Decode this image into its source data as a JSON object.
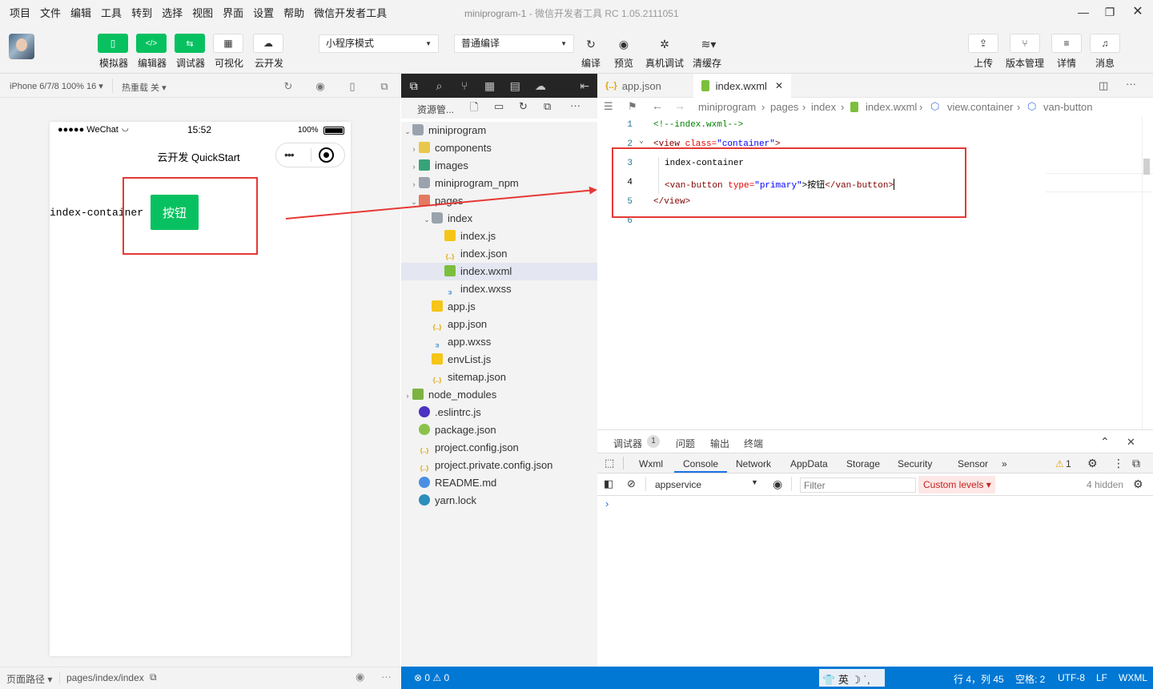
{
  "menubar": {
    "items": [
      "项目",
      "文件",
      "编辑",
      "工具",
      "转到",
      "选择",
      "视图",
      "界面",
      "设置",
      "帮助",
      "微信开发者工具"
    ],
    "title": "miniprogram-1",
    "subtitle": "微信开发者工具 RC 1.05.2111051"
  },
  "toolbar": {
    "simulator": "模拟器",
    "editor": "编辑器",
    "debugger": "调试器",
    "visual": "可视化",
    "cloud": "云开发",
    "mode": "小程序模式",
    "compile_mode": "普通编译",
    "compile": "编译",
    "preview": "预览",
    "real_debug": "真机调试",
    "clear_cache": "清缓存",
    "upload": "上传",
    "version": "版本管理",
    "details": "详情",
    "messages": "消息"
  },
  "simulator": {
    "device": "iPhone 6/7/8 100% 16 ▾",
    "hot_reload": "热重载 关 ▾",
    "status_bar": {
      "carrier": "●●●●● WeChat",
      "time": "15:52",
      "battery": "100%"
    },
    "nav_title": "云开发 QuickStart",
    "container_text": "index-container",
    "button_text": "按钮",
    "page_path_label": "页面路径 ▾",
    "page_path": "pages/index/index"
  },
  "explorer": {
    "header": "资源管...",
    "tree": [
      {
        "label": "miniprogram",
        "icon": "folder",
        "indent": 0,
        "tw": "⌄"
      },
      {
        "label": "components",
        "icon": "comp",
        "indent": 1,
        "tw": "›"
      },
      {
        "label": "images",
        "icon": "img",
        "indent": 1,
        "tw": "›"
      },
      {
        "label": "miniprogram_npm",
        "icon": "folder",
        "indent": 1,
        "tw": "›"
      },
      {
        "label": "pages",
        "icon": "pages",
        "indent": 1,
        "tw": "⌄"
      },
      {
        "label": "index",
        "icon": "folder",
        "indent": 2,
        "tw": "⌄"
      },
      {
        "label": "index.js",
        "icon": "js",
        "indent": 3,
        "tw": ""
      },
      {
        "label": "index.json",
        "icon": "json",
        "indent": 3,
        "tw": ""
      },
      {
        "label": "index.wxml",
        "icon": "wxml",
        "indent": 3,
        "tw": "",
        "selected": true
      },
      {
        "label": "index.wxss",
        "icon": "wxss",
        "indent": 3,
        "tw": ""
      },
      {
        "label": "app.js",
        "icon": "js",
        "indent": 2,
        "tw": ""
      },
      {
        "label": "app.json",
        "icon": "json",
        "indent": 2,
        "tw": ""
      },
      {
        "label": "app.wxss",
        "icon": "wxss",
        "indent": 2,
        "tw": ""
      },
      {
        "label": "envList.js",
        "icon": "js",
        "indent": 2,
        "tw": ""
      },
      {
        "label": "sitemap.json",
        "icon": "json",
        "indent": 2,
        "tw": ""
      },
      {
        "label": "node_modules",
        "icon": "node",
        "indent": 0,
        "tw": "›"
      },
      {
        "label": ".eslintrc.js",
        "icon": "eslint",
        "indent": 1,
        "tw": ""
      },
      {
        "label": "package.json",
        "icon": "pkg",
        "indent": 1,
        "tw": ""
      },
      {
        "label": "project.config.json",
        "icon": "json",
        "indent": 1,
        "tw": ""
      },
      {
        "label": "project.private.config.json",
        "icon": "json",
        "indent": 1,
        "tw": ""
      },
      {
        "label": "README.md",
        "icon": "info",
        "indent": 1,
        "tw": ""
      },
      {
        "label": "yarn.lock",
        "icon": "yarn",
        "indent": 1,
        "tw": ""
      }
    ],
    "status": "⊗ 0 ⚠ 0"
  },
  "editor": {
    "tabs": [
      {
        "label": "app.json",
        "active": false
      },
      {
        "label": "index.wxml",
        "active": true
      }
    ],
    "breadcrumb": [
      "miniprogram",
      "pages",
      "index",
      "index.wxml",
      "view.container",
      "van-button"
    ],
    "lines": [
      "1",
      "2",
      "3",
      "4",
      "5",
      "6"
    ],
    "code": {
      "l1_comment": "<!--index.wxml-->",
      "l2_open": "<view ",
      "l2_attr": "class=",
      "l2_val": "\"container\"",
      "l2_close": ">",
      "l3": "index-container",
      "l4_open": "<van-button ",
      "l4_attr": "type=",
      "l4_val": "\"primary\"",
      "l4_text": ">按钮",
      "l4_close": "</van-button>",
      "l5": "</view>"
    }
  },
  "devtools": {
    "top_tabs": [
      "调试器",
      "问题",
      "输出",
      "终端"
    ],
    "badge": "1",
    "tabs": [
      "Wxml",
      "Console",
      "Network",
      "AppData",
      "Storage",
      "Security",
      "Sensor"
    ],
    "warn_count": "1",
    "context": "appservice",
    "filter_placeholder": "Filter",
    "levels": "Custom levels ▾",
    "hidden": "4 hidden",
    "prompt": "›"
  },
  "statusbar": {
    "ime": "英",
    "position": "行 4，列 45",
    "spaces": "空格: 2",
    "encoding": "UTF-8",
    "eol": "LF",
    "language": "WXML"
  }
}
